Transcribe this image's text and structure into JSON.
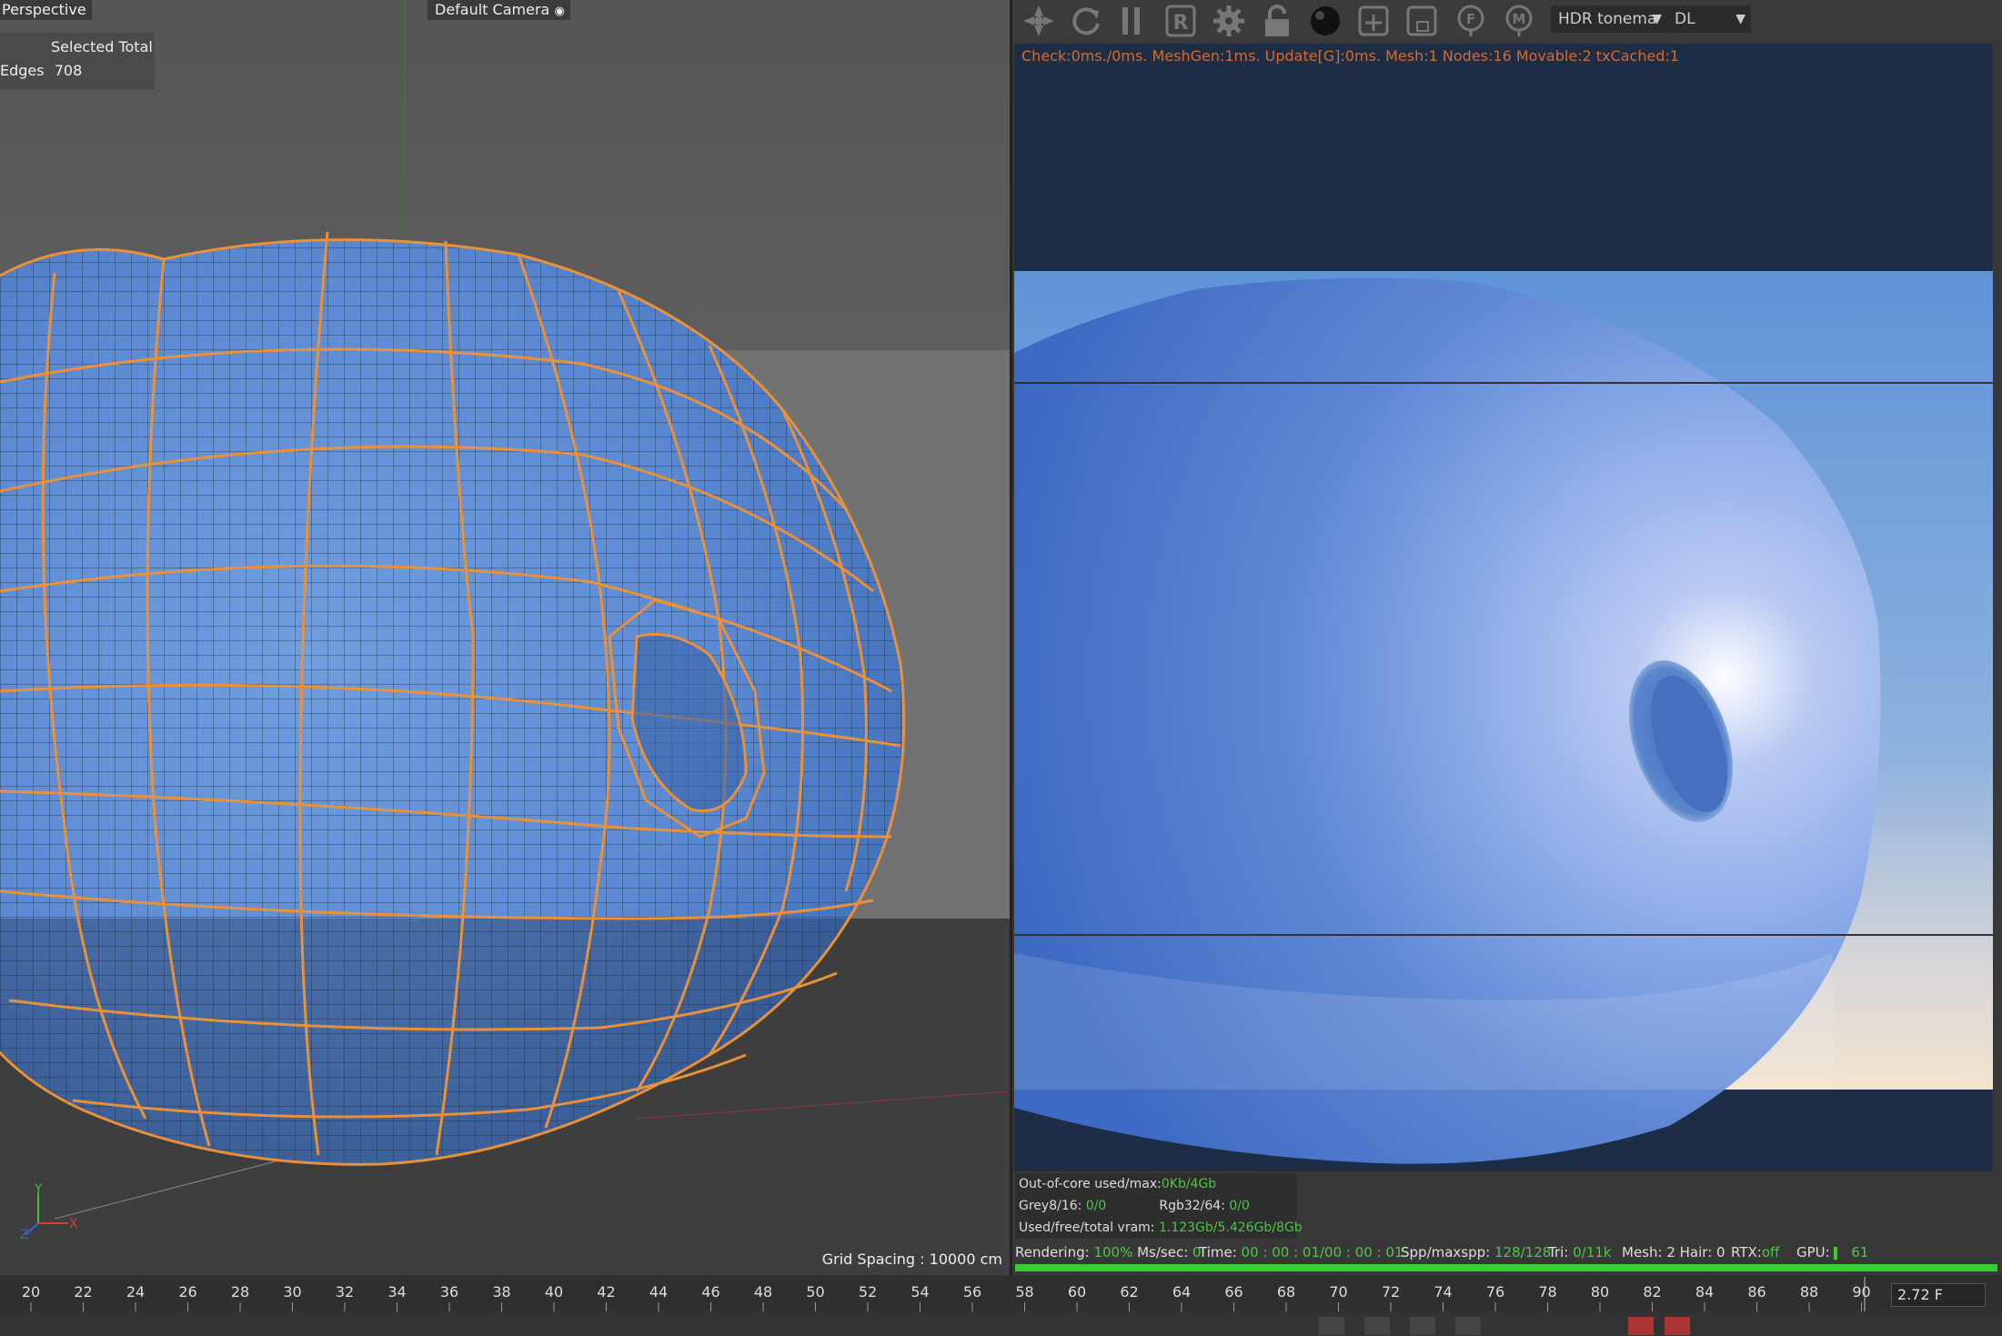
{
  "viewport": {
    "title": "Perspective",
    "camera": "Default Camera",
    "stats_header": "Selected Total",
    "stats_label": "Edges",
    "stats_value": "708",
    "grid_spacing": "Grid Spacing : 10000 cm",
    "axes": {
      "y": "Y",
      "x": "X",
      "z": "Z"
    }
  },
  "render": {
    "toolbar_icons": [
      "send-to-icon",
      "refresh-icon",
      "pause-icon",
      "region-render-icon",
      "settings-gear-icon",
      "lock-icon",
      "material-sphere-icon",
      "add-node-icon",
      "clay-mode-icon",
      "f-pass-icon",
      "m-pass-icon"
    ],
    "tonemap_select": "HDR tonema",
    "kernel_select": "DL",
    "debug_line": "Check:0ms./0ms. MeshGen:1ms. Update[G]:0ms. Mesh:1 Nodes:16 Movable:2 txCached:1",
    "ooc_label": "Out-of-core used/max:",
    "ooc_value": "0Kb/4Gb",
    "grey_label": "Grey8/16:",
    "grey_value": "0/0",
    "rgb_label": "Rgb32/64:",
    "rgb_value": "0/0",
    "vram_label": "Used/free/total vram:",
    "vram_value": "1.123Gb/5.426Gb/8Gb",
    "status": {
      "rendering_label": "Rendering:",
      "rendering_value": "100%",
      "mssec_label": "Ms/sec:",
      "mssec_value": "0",
      "time_label": "Time:",
      "time_value": "00 : 00 : 01/00 : 00 : 01",
      "spp_label": "Spp/maxspp:",
      "spp_value": "128/128",
      "tri_label": "Tri:",
      "tri_value": "0/11k",
      "mesh_label": "Mesh:",
      "mesh_value": "2",
      "hair_label": "Hair:",
      "hair_value": "0",
      "rtx_label": "RTX:",
      "rtx_value": "off",
      "gpu_label": "GPU:",
      "gpu_value": "61"
    },
    "progress": 1.0
  },
  "timeline": {
    "ticks": [
      "20",
      "22",
      "24",
      "26",
      "28",
      "30",
      "32",
      "34",
      "36",
      "38",
      "40",
      "42",
      "44",
      "46",
      "48",
      "50",
      "52",
      "54",
      "56",
      "58",
      "60",
      "62",
      "64",
      "66",
      "68",
      "70",
      "72",
      "74",
      "76",
      "78",
      "80",
      "82",
      "84",
      "86",
      "88",
      "90"
    ],
    "current_frame": "2.72 F"
  },
  "colors": {
    "wire": "#e8903a",
    "mesh": "#5b8fd8",
    "progress": "#33d030",
    "debug": "#d86a30"
  }
}
